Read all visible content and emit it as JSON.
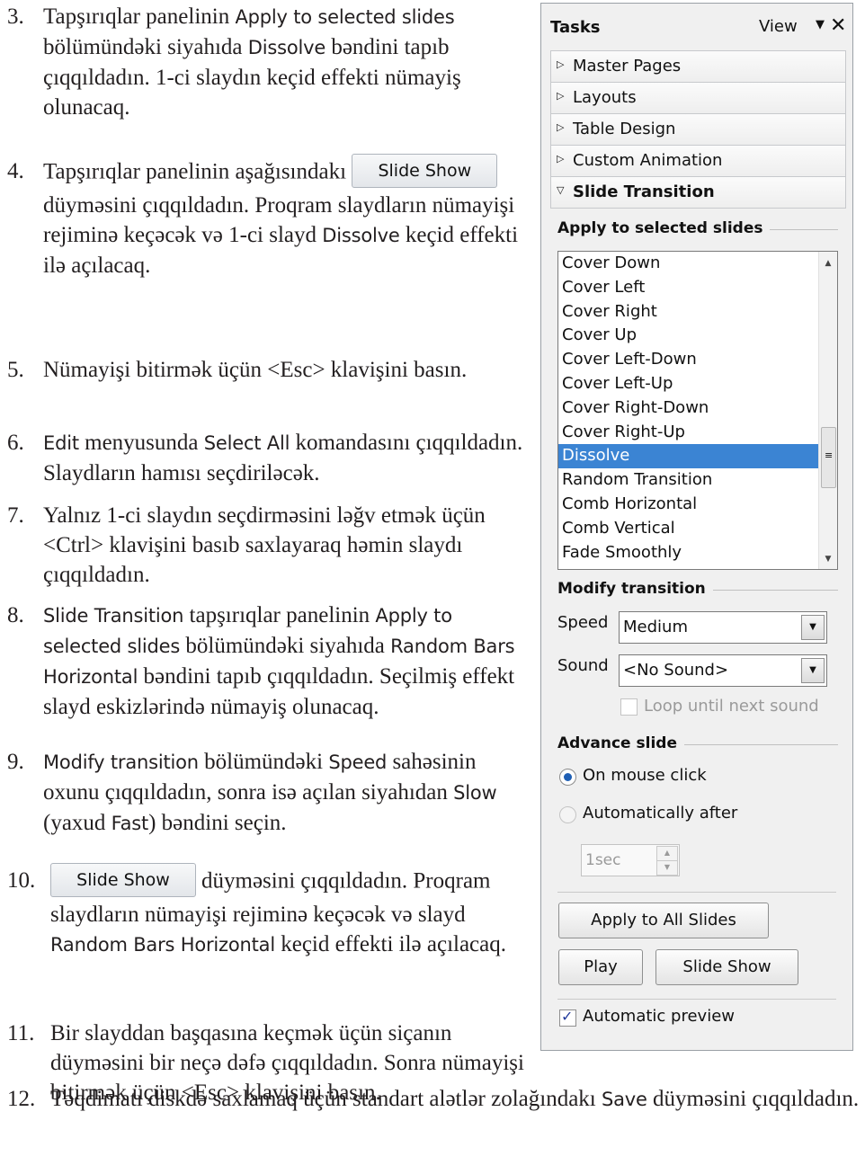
{
  "steps": [
    {
      "num": "3.",
      "parts": [
        {
          "t": "Tapşırıqlar panelinin "
        },
        {
          "t": "Apply to selected slides",
          "ui": true
        },
        {
          "t": " bölümündəki siyahıda "
        },
        {
          "t": "Dissolve",
          "ui": true
        },
        {
          "t": " bəndini tapıb çıqqıldadın. 1-ci slaydın keçid effekti nümayiş olunacaq."
        }
      ]
    },
    {
      "num": "4.",
      "parts": [
        {
          "t": "Tapşırıqlar panelinin aşağısındakı "
        },
        {
          "btn": "Slide Show"
        },
        {
          "t": "düyməsini çıqqıldadın. Proqram slaydların nümayişi rejiminə keçəcək və 1-ci slayd "
        },
        {
          "t": "Dissolve",
          "ui": true
        },
        {
          "t": " keçid effekti ilə açılacaq."
        }
      ]
    },
    {
      "num": "5.",
      "parts": [
        {
          "t": "Nümayişi bitirmək üçün <Esc> klavişini basın."
        }
      ]
    },
    {
      "num": "6.",
      "parts": [
        {
          "t": "Edit",
          "ui": true
        },
        {
          "t": " menyusunda "
        },
        {
          "t": "Select All",
          "ui": true
        },
        {
          "t": " komandasını çıqqıldadın. Slaydların hamısı seçdiriləcək."
        }
      ]
    },
    {
      "num": "7.",
      "parts": [
        {
          "t": "Yalnız 1-ci slaydın seçdirməsini ləğv etmək üçün <Ctrl> klavişini basıb saxlayaraq həmin slaydı çıqqıldadın."
        }
      ]
    },
    {
      "num": "8.",
      "parts": [
        {
          "t": "Slide Transition",
          "ui": true
        },
        {
          "t": " tapşırıqlar panelinin "
        },
        {
          "t": "Apply to selected slides",
          "ui": true
        },
        {
          "t": " bölümündəki siyahıda "
        },
        {
          "t": "Random Bars Horizontal",
          "ui": true
        },
        {
          "t": " bəndini tapıb çıqqıldadın. Seçilmiş effekt slayd eskizlərində nümayiş olunacaq."
        }
      ]
    },
    {
      "num": "9.",
      "parts": [
        {
          "t": "Modify transition",
          "ui": true
        },
        {
          "t": " bölümündəki "
        },
        {
          "t": "Speed",
          "ui": true
        },
        {
          "t": " sahəsinin oxunu çıqqıldadın, sonra isə açılan siyahıdan "
        },
        {
          "t": "Slow",
          "ui": true
        },
        {
          "t": " (yaxud "
        },
        {
          "t": "Fast",
          "ui": true
        },
        {
          "t": ") bəndini seçin."
        }
      ]
    },
    {
      "num": "10.",
      "parts": [
        {
          "btn": "Slide Show"
        },
        {
          "t": "düyməsini çıqqıldadın. Proqram slaydların nümayişi rejiminə keçəcək və slayd "
        },
        {
          "t": "Random Bars Horizontal",
          "ui": true
        },
        {
          "t": " keçid effekti ilə açılacaq."
        }
      ]
    },
    {
      "num": "11.",
      "parts": [
        {
          "t": "Bir slayddan başqasına keçmək üçün siçanın düyməsini bir neçə dəfə çıqqıldadın. Sonra nümayişi bitirmək üçün <Esc> klavişini basın."
        }
      ]
    }
  ],
  "final_step": {
    "num": "12.",
    "parts": [
      {
        "t": "Təqdimatı diskdə saxlamaq üçün standart alətlər zolağındakı "
      },
      {
        "t": "Save",
        "ui": true
      },
      {
        "t": " düyməsini çıqqıldadın."
      }
    ]
  },
  "pane": {
    "title": "Tasks",
    "view_label": "View",
    "sections": [
      "Master Pages",
      "Layouts",
      "Table Design",
      "Custom Animation",
      "Slide Transition"
    ],
    "apply_group": "Apply to selected slides",
    "transitions": [
      "Cover Down",
      "Cover Left",
      "Cover Right",
      "Cover Up",
      "Cover Left-Down",
      "Cover Left-Up",
      "Cover Right-Down",
      "Cover Right-Up",
      "Dissolve",
      "Random Transition",
      "Comb Horizontal",
      "Comb Vertical",
      "Fade Smoothly"
    ],
    "selected_transition": "Dissolve",
    "modify_group": "Modify transition",
    "speed_label": "Speed",
    "speed_value": "Medium",
    "sound_label": "Sound",
    "sound_value": "<No Sound>",
    "loop_label": "Loop until next sound",
    "advance_group": "Advance slide",
    "on_click_label": "On mouse click",
    "auto_label": "Automatically after",
    "auto_value": "1sec",
    "apply_all_button": "Apply to All Slides",
    "play_button": "Play",
    "slideshow_button": "Slide Show",
    "auto_preview_label": "Automatic preview",
    "auto_preview_checked": true
  }
}
